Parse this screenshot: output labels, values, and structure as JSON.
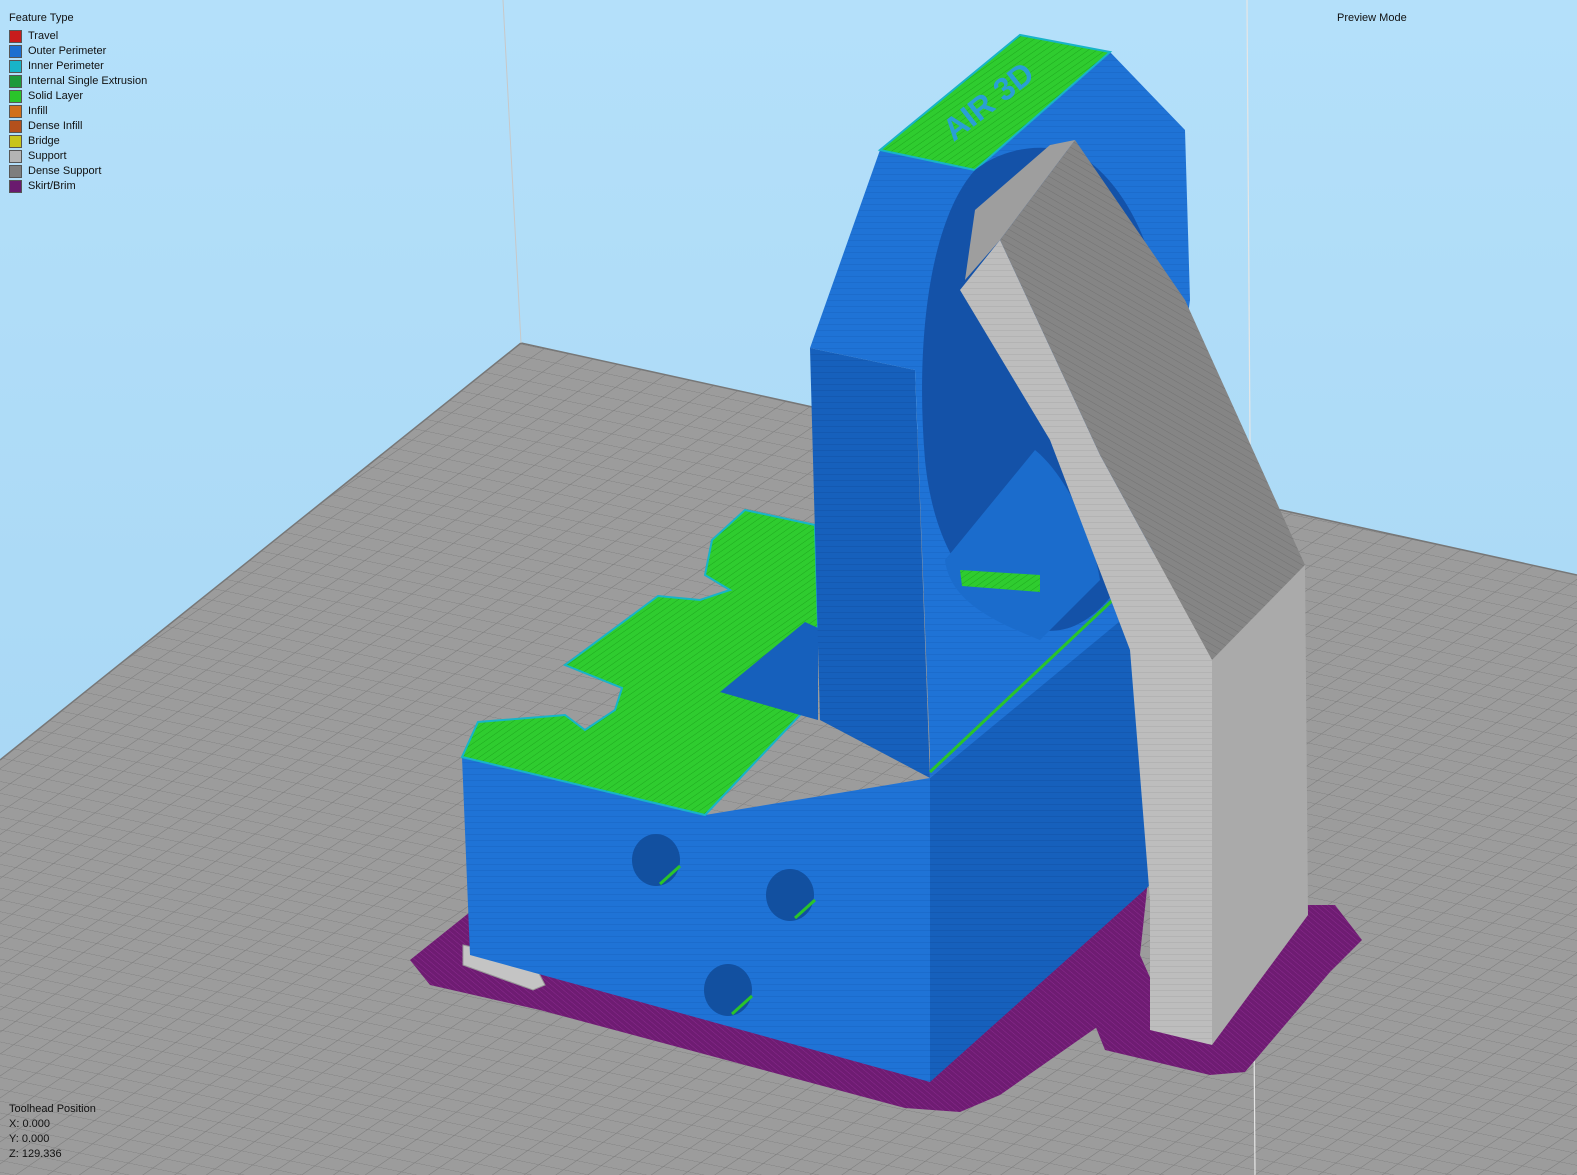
{
  "legend": {
    "title": "Feature Type",
    "items": [
      {
        "label": "Travel",
        "color": "#c81c1c"
      },
      {
        "label": "Outer Perimeter",
        "color": "#1c6fd0"
      },
      {
        "label": "Inner Perimeter",
        "color": "#18b4c8"
      },
      {
        "label": "Internal Single Extrusion",
        "color": "#1e9a3a"
      },
      {
        "label": "Solid Layer",
        "color": "#2ac42a"
      },
      {
        "label": "Infill",
        "color": "#d0701c"
      },
      {
        "label": "Dense Infill",
        "color": "#b4501c"
      },
      {
        "label": "Bridge",
        "color": "#c8c41c"
      },
      {
        "label": "Support",
        "color": "#b4b4b4"
      },
      {
        "label": "Dense Support",
        "color": "#7e7e7e"
      },
      {
        "label": "Skirt/Brim",
        "color": "#6a1a6e"
      }
    ]
  },
  "mode": {
    "label": "Preview Mode"
  },
  "toolhead": {
    "title": "Toolhead Position",
    "x": "X: 0.000",
    "y": "Y: 0.000",
    "z": "Z: 129.336"
  },
  "model": {
    "embossed_text": "AIR 3D"
  },
  "colors": {
    "background": "#aedcf8",
    "bed": "#9a9a9a",
    "grid": "#7e7e7e",
    "outer_perimeter": "#1c6fd0",
    "solid_layer": "#2ac42a",
    "inner_perimeter": "#18b4c8",
    "support": "#b4b4b4",
    "dense_support": "#7e7e7e",
    "skirt": "#6a1a6e"
  }
}
